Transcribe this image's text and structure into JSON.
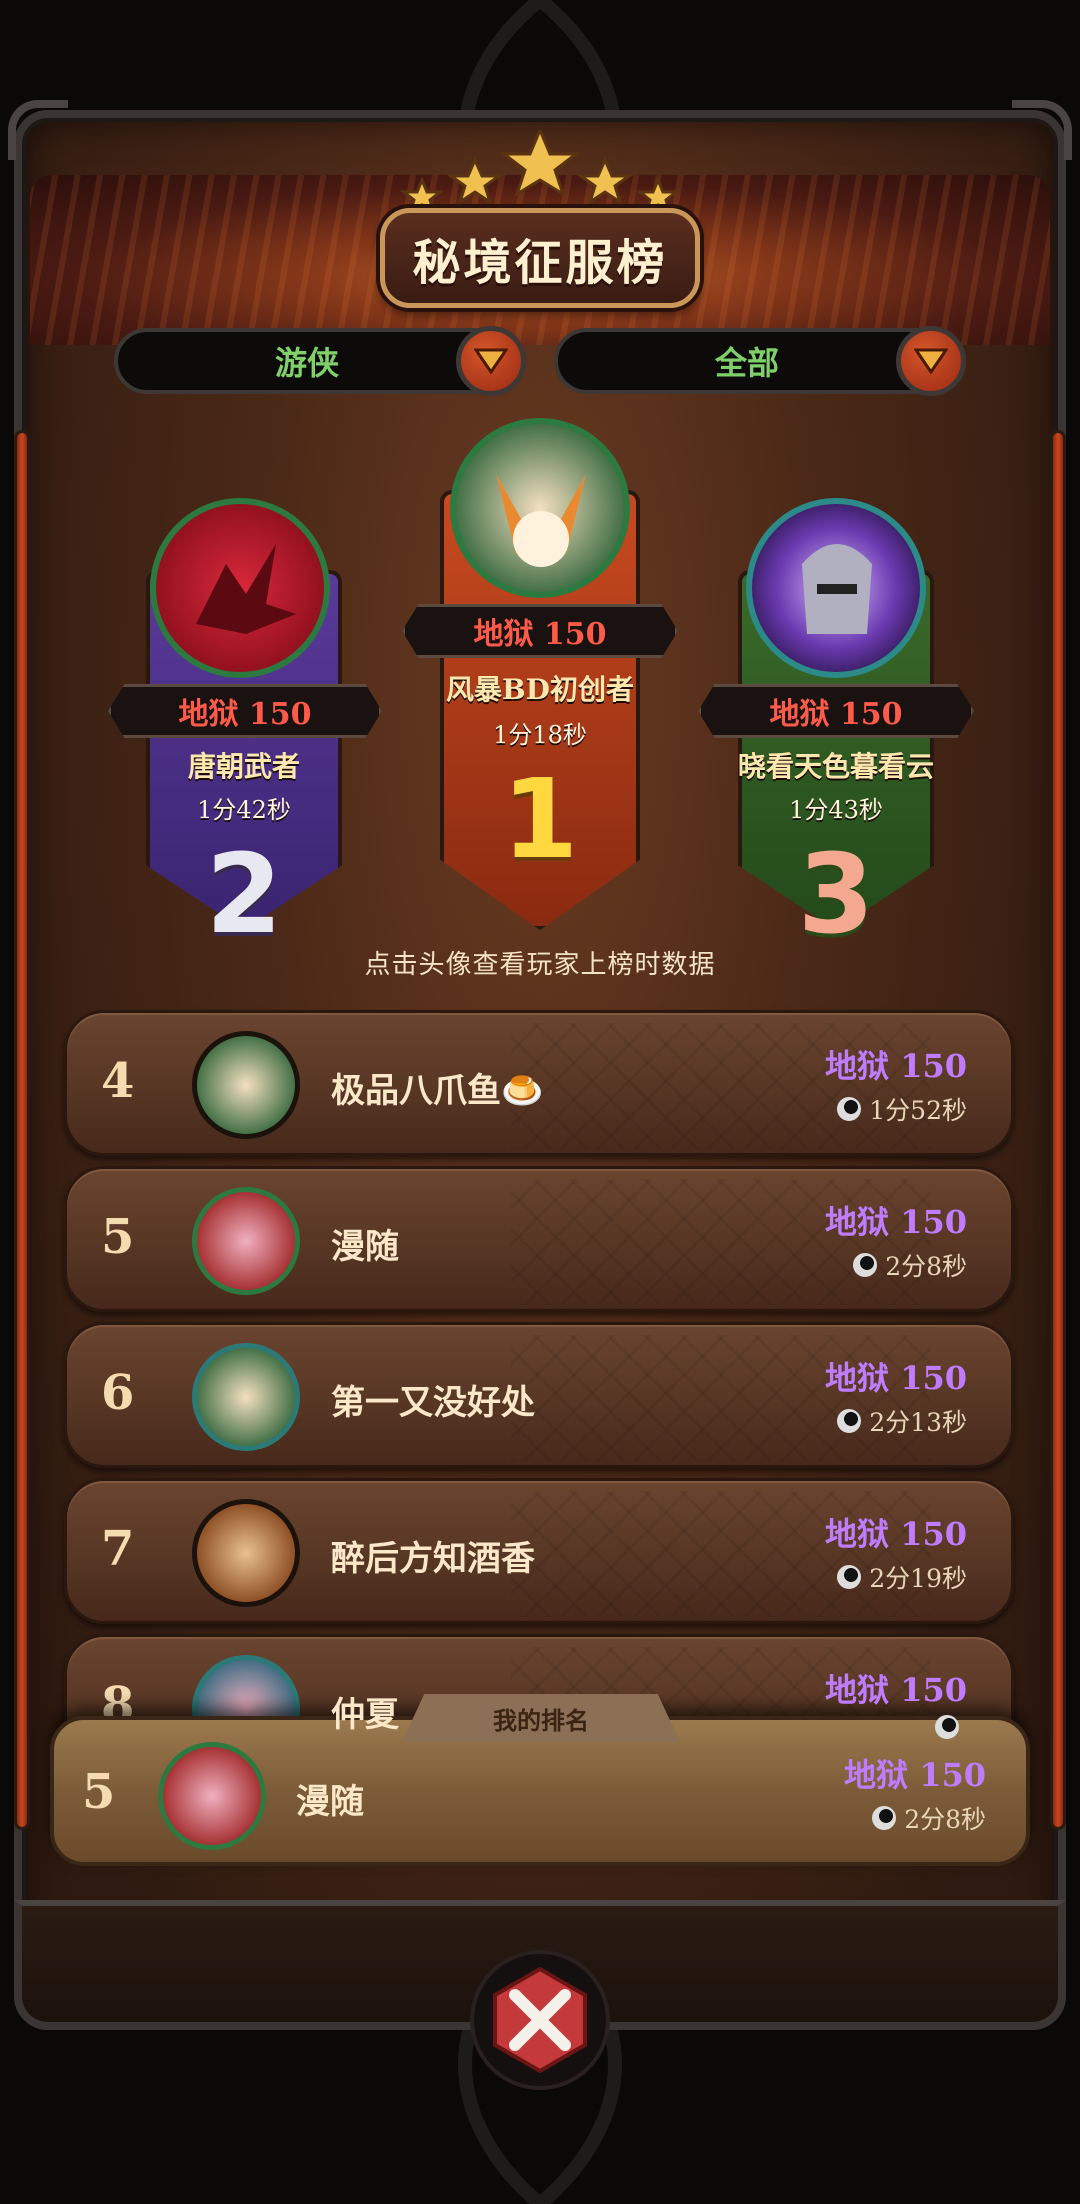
{
  "title": "秘境征服榜",
  "filters": {
    "class": "游侠",
    "scope": "全部"
  },
  "podium": [
    {
      "rank": "1",
      "difficulty": "地狱 150",
      "name": "风暴BD初创者",
      "time": "1分18秒"
    },
    {
      "rank": "2",
      "difficulty": "地狱 150",
      "name": "唐朝武者",
      "time": "1分42秒"
    },
    {
      "rank": "3",
      "difficulty": "地狱 150",
      "name": "晓看天色暮看云",
      "time": "1分43秒"
    }
  ],
  "hint": "点击头像查看玩家上榜时数据",
  "rows": [
    {
      "rank": "4",
      "name": "极品八爪鱼🍮",
      "difficulty": "地狱 150",
      "time": "1分52秒"
    },
    {
      "rank": "5",
      "name": "漫随",
      "difficulty": "地狱 150",
      "time": "2分8秒"
    },
    {
      "rank": "6",
      "name": "第一又没好处",
      "difficulty": "地狱 150",
      "time": "2分13秒"
    },
    {
      "rank": "7",
      "name": "醉后方知酒香",
      "difficulty": "地狱 150",
      "time": "2分19秒"
    },
    {
      "rank": "8",
      "name": "仲夏",
      "difficulty": "地狱 150",
      "time": ""
    }
  ],
  "my_rank": {
    "tab_label": "我的排名",
    "rank": "5",
    "name": "漫随",
    "difficulty": "地狱 150",
    "time": "2分8秒"
  },
  "colors": {
    "difficulty_red": "#ff5a4a",
    "difficulty_purple": "#c07cff",
    "filter_green": "#7fd06a"
  },
  "icons": [
    "star-icon",
    "chevron-down-icon",
    "dragon-avatar-icon",
    "fox-avatar-icon",
    "helmet-avatar-icon",
    "cow-avatar-icon",
    "bear-avatar-icon",
    "clock-icon",
    "close-icon"
  ]
}
